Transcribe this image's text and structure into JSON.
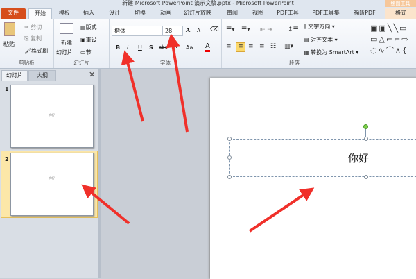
{
  "window": {
    "title": "新建 Microsoft PowerPoint 演示文稿.pptx - Microsoft PowerPoint",
    "context_tab_group": "绘图工具"
  },
  "tabs": [
    "文件",
    "开始",
    "模板",
    "插入",
    "设计",
    "切换",
    "动画",
    "幻灯片放映",
    "审阅",
    "视图",
    "PDF工具",
    "PDF工具集",
    "福昕PDF",
    "格式"
  ],
  "ribbon": {
    "clipboard": {
      "paste": "粘贴",
      "cut": "剪切",
      "copy": "复制",
      "format_painter": "格式刷",
      "label": "剪贴板"
    },
    "slides": {
      "new_slide": "新建",
      "new_slide2": "幻灯片",
      "layout": "版式",
      "reset": "重设",
      "section": "节",
      "label": "幻灯片"
    },
    "font": {
      "font_name": "楷体",
      "font_size": "28",
      "bold": "B",
      "italic": "I",
      "underline": "U",
      "shadow": "S",
      "strike": "abc",
      "spacing": "AV",
      "case": "Aa",
      "color": "A",
      "grow": "A",
      "shrink": "A",
      "label": "字体"
    },
    "paragraph": {
      "text_direction": "文字方向",
      "align_text": "对齐文本",
      "smartart": "转换为 SmartArt",
      "label": "段落"
    }
  },
  "panel": {
    "tabs": [
      "幻灯片",
      "大纲"
    ],
    "slides": [
      {
        "num": "1",
        "text": "你好"
      },
      {
        "num": "2",
        "text": "你好"
      }
    ]
  },
  "slide": {
    "text": "你好"
  },
  "colors": {
    "file_tab": "#d64d1b",
    "arrow": "#f0302a",
    "active_thumb": "#fce7a8"
  }
}
